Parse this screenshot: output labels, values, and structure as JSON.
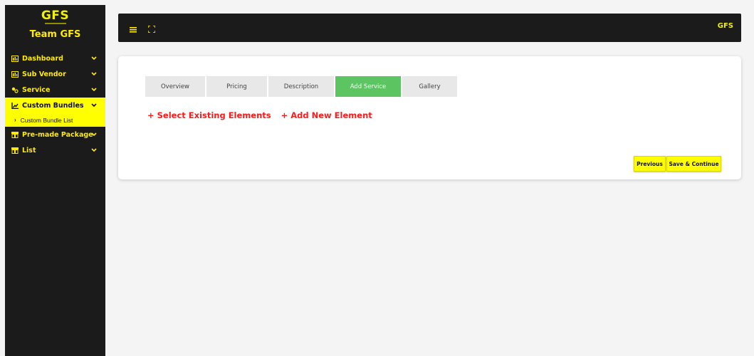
{
  "brand": {
    "logo": "GFS",
    "team": "Team GFS"
  },
  "sidebar": {
    "items": [
      {
        "label": "Dashboard",
        "icon": "dashboard-icon"
      },
      {
        "label": "Sub Vendor",
        "icon": "vendor-icon"
      },
      {
        "label": "Service",
        "icon": "service-icon"
      },
      {
        "label": "Custom Bundles",
        "icon": "chart-icon",
        "active": true
      },
      {
        "label": "Pre-made Package",
        "icon": "package-icon"
      },
      {
        "label": "List",
        "icon": "list-icon"
      }
    ],
    "submenu": {
      "label": "Custom Bundle List"
    }
  },
  "topbar": {
    "logo": "GFS"
  },
  "tabs": [
    {
      "label": "Overview"
    },
    {
      "label": "Pricing"
    },
    {
      "label": "Description"
    },
    {
      "label": "Add Service",
      "active": true
    },
    {
      "label": "Gallery"
    }
  ],
  "actions": {
    "select_existing": "+ Select Existing Elements",
    "add_new": "+ Add New Element"
  },
  "buttons": {
    "previous": "Previous",
    "save_continue": "Save & Continue"
  },
  "colors": {
    "accent": "#ffff00",
    "sidebar_bg": "#1b1b1b",
    "active_tab": "#5cc461",
    "link_red": "#ff1a1a"
  }
}
